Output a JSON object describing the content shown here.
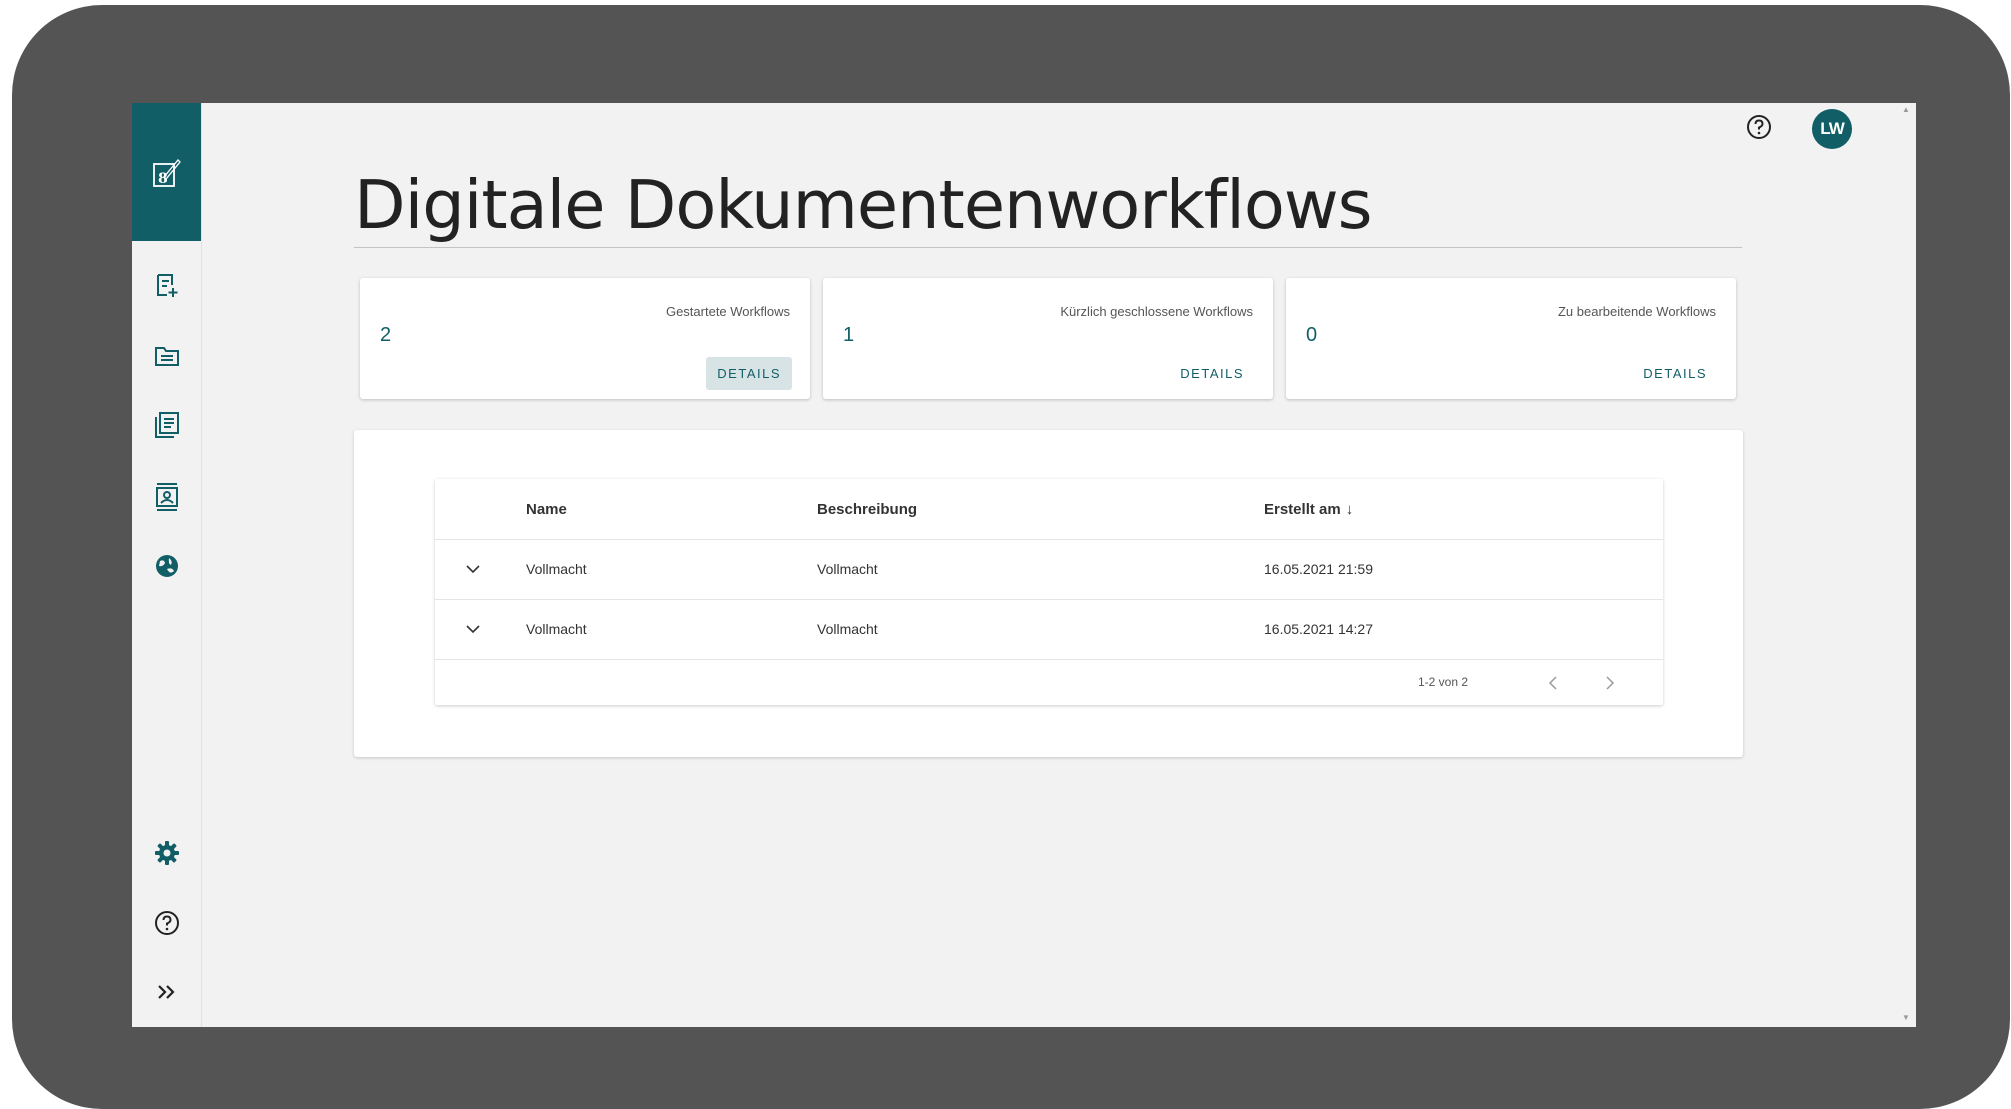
{
  "header": {
    "title": "Digitale Dokumentenworkflows",
    "avatar_initials": "LW"
  },
  "sidebar": {
    "items": [
      {
        "icon": "new-document-icon"
      },
      {
        "icon": "folder-icon"
      },
      {
        "icon": "document-list-icon"
      },
      {
        "icon": "contacts-icon"
      },
      {
        "icon": "globe-icon"
      }
    ],
    "bottom_items": [
      {
        "icon": "gear-icon"
      },
      {
        "icon": "help-icon"
      },
      {
        "icon": "expand-icon",
        "label": "»"
      }
    ]
  },
  "stats": [
    {
      "label": "Gestartete Workflows",
      "count": "2",
      "button": "DETAILS"
    },
    {
      "label": "Kürzlich geschlossene Workflows",
      "count": "1",
      "button": "DETAILS"
    },
    {
      "label": "Zu bearbeitende Workflows",
      "count": "0",
      "button": "DETAILS"
    }
  ],
  "table": {
    "columns": {
      "name": "Name",
      "description": "Beschreibung",
      "created": "Erstellt am",
      "sort_indicator": "↓"
    },
    "rows": [
      {
        "name": "Vollmacht",
        "description": "Vollmacht",
        "created": "16.05.2021 21:59"
      },
      {
        "name": "Vollmacht",
        "description": "Vollmacht",
        "created": "16.05.2021 14:27"
      }
    ],
    "pagination": {
      "range": "1-2 von 2"
    }
  },
  "colors": {
    "accent": "#115e67",
    "frame": "#545454",
    "background": "#f2f2f2"
  }
}
